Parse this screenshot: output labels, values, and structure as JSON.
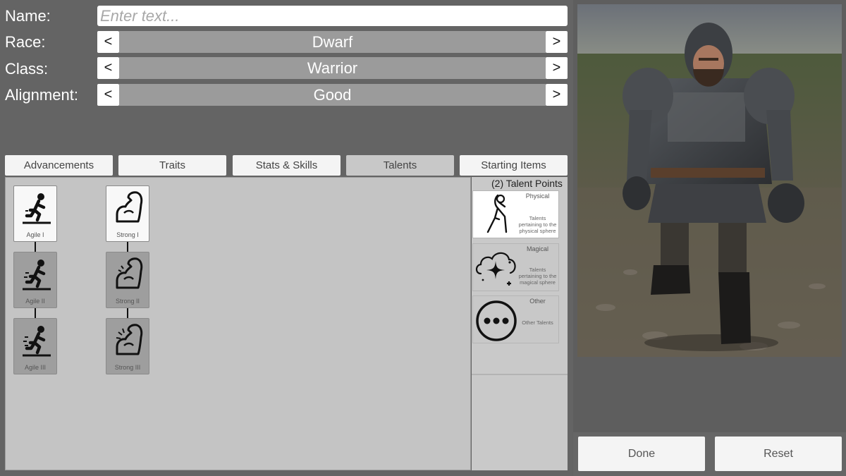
{
  "form": {
    "name_label": "Name:",
    "name_placeholder": "Enter text...",
    "race": {
      "label": "Race:",
      "value": "Dwarf",
      "prev": "<",
      "next": ">"
    },
    "class": {
      "label": "Class:",
      "value": "Warrior",
      "prev": "<",
      "next": ">"
    },
    "alignment": {
      "label": "Alignment:",
      "value": "Good",
      "prev": "<",
      "next": ">"
    }
  },
  "tabs": [
    {
      "label": "Advancements"
    },
    {
      "label": "Traits"
    },
    {
      "label": "Stats & Skills"
    },
    {
      "label": "Talents",
      "active": true
    },
    {
      "label": "Starting Items"
    }
  ],
  "talent_tree": {
    "agile": [
      {
        "label": "Agile I",
        "unlocked": true
      },
      {
        "label": "Agile II",
        "unlocked": false
      },
      {
        "label": "Agile III",
        "unlocked": false
      }
    ],
    "strong": [
      {
        "label": "Strong I",
        "unlocked": true
      },
      {
        "label": "Strong II",
        "unlocked": false
      },
      {
        "label": "Strong III",
        "unlocked": false
      }
    ]
  },
  "talent_points": "(2) Talent Points",
  "categories": [
    {
      "title": "Physical",
      "desc": "Talents pertaining to the physical sphere",
      "icon": "physical-figure-icon",
      "selected": true
    },
    {
      "title": "Magical",
      "desc": "Talents pertaining to the magical sphere",
      "icon": "magic-cloud-icon",
      "selected": false
    },
    {
      "title": "Other",
      "desc": "Other Talents",
      "icon": "ellipsis-icon",
      "selected": false
    }
  ],
  "actions": {
    "done": "Done",
    "reset": "Reset"
  }
}
